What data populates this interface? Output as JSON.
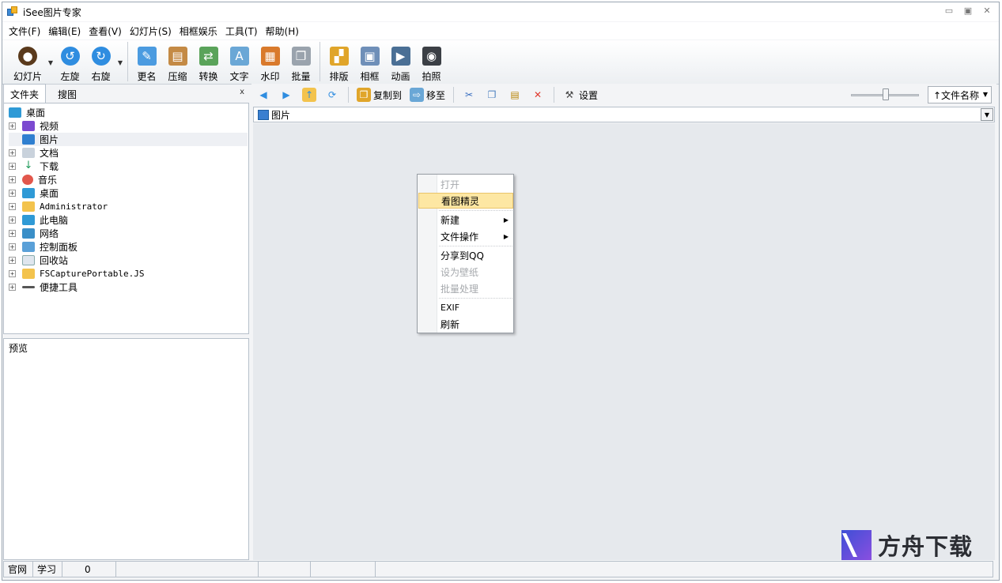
{
  "window": {
    "title": "iSee图片专家"
  },
  "menubar": [
    "文件(F)",
    "编辑(E)",
    "查看(V)",
    "幻灯片(S)",
    "相框娱乐",
    "工具(T)",
    "帮助(H)"
  ],
  "toolbar": {
    "slideshow": "幻灯片",
    "rotate_left": "左旋",
    "rotate_right": "右旋",
    "rename": "更名",
    "compress": "压缩",
    "convert": "转换",
    "text": "文字",
    "watermark": "水印",
    "batch": "批量",
    "layout": "排版",
    "frame": "相框",
    "animation": "动画",
    "photo": "拍照"
  },
  "left": {
    "tab_folders": "文件夹",
    "tab_search": "搜图",
    "close": "x",
    "tree": [
      "桌面",
      "视频",
      "图片",
      "文档",
      "下载",
      "音乐",
      "桌面",
      "Administrator",
      "此电脑",
      "网络",
      "控制面板",
      "回收站",
      "FSCapturePortable.JS",
      "便捷工具"
    ],
    "preview_label": "预览"
  },
  "right_toolbar": {
    "copy_to": "复制到",
    "move_to": "移至",
    "settings": "设置",
    "sort": "↑文件名称"
  },
  "path": {
    "current": "图片"
  },
  "context_menu": {
    "open": "打开",
    "viewer": "看图精灵",
    "new": "新建",
    "file_ops": "文件操作",
    "share_qq": "分享到QQ",
    "set_wallpaper": "设为壁纸",
    "batch_process": "批量处理",
    "exif": "EXIF",
    "refresh": "刷新"
  },
  "status": {
    "website": "官网",
    "learn": "学习",
    "count": "0"
  },
  "watermark": {
    "text": "方舟下载"
  }
}
